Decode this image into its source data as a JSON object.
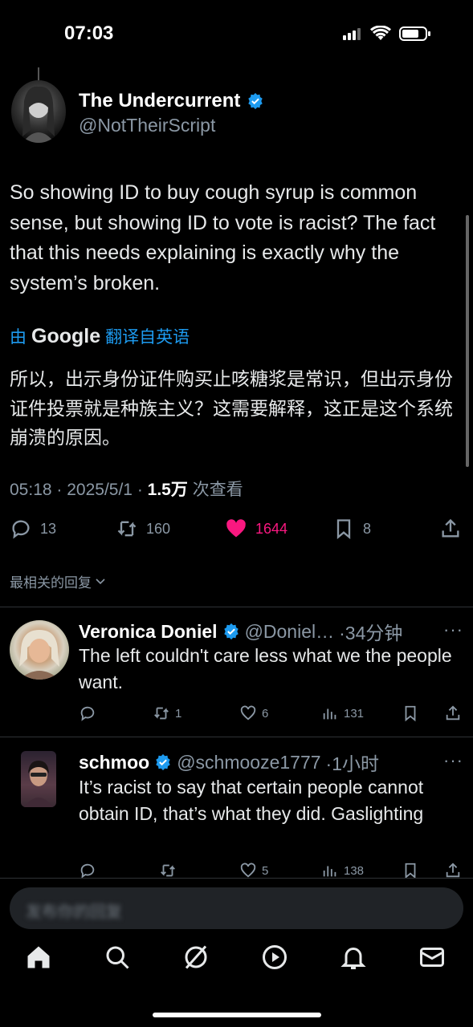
{
  "status": {
    "time": "07:03"
  },
  "tweet": {
    "author_name": "The Undercurrent",
    "author_handle": "@NotTheirScript",
    "text": "So showing ID to buy cough syrup is common sense, but showing ID to vote is racist? The fact that this needs explaining is exactly why the system’s broken.",
    "translate_prefix": "由",
    "translate_brand": "Google",
    "translate_suffix": "翻译自英语",
    "translated_text": "所以，出示身份证件购买止咳糖浆是常识，但出示身份证件投票就是种族主义？这需要解释，这正是这个系统崩溃的原因。",
    "time": "05:18",
    "date": "2025/5/1",
    "views": "1.5万",
    "views_label": "次查看",
    "replies": "13",
    "retweets": "160",
    "likes": "1644",
    "bookmarks": "8"
  },
  "sort_label": "最相关的回复",
  "replies": [
    {
      "name": "Veronica Doniel",
      "handle": "@Doniel…",
      "time": "·34分钟",
      "text": "The left couldn't care less what we the people want.",
      "replies": "",
      "retweets": "1",
      "likes": "6",
      "views": "131"
    },
    {
      "name": "schmoo",
      "handle": "@schmooze1777",
      "time": "·1小时",
      "text": "It’s racist to say that certain people cannot obtain ID, that’s what they did. Gaslighting",
      "replies": "",
      "retweets": "",
      "likes": "5",
      "views": "138"
    }
  ],
  "compose": {
    "placeholder": "发布你的回复"
  },
  "colors": {
    "accent": "#1d9bf0",
    "like": "#f91880",
    "background": "#000000"
  },
  "icons": [
    "home-icon",
    "search-icon",
    "grok-icon",
    "video-icon",
    "notifications-icon",
    "messages-icon"
  ]
}
